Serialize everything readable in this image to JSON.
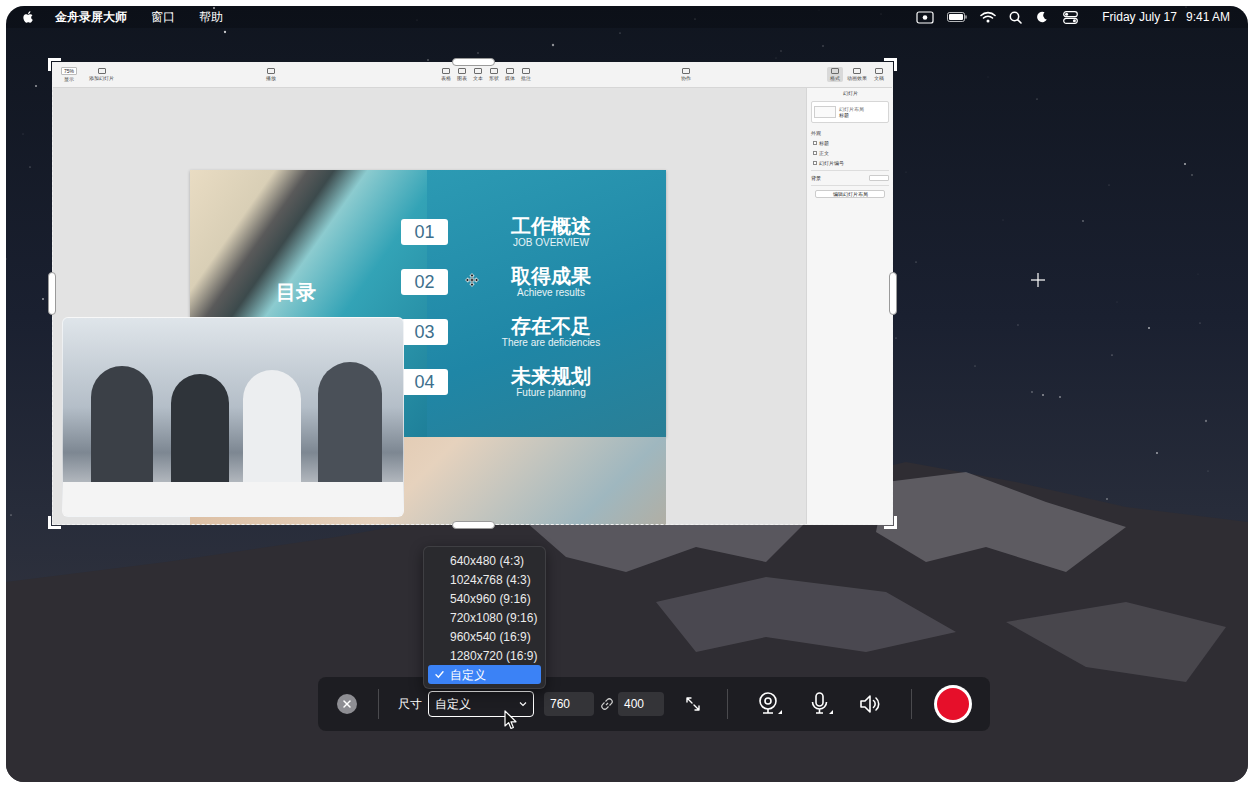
{
  "menu_bar": {
    "app_name": "金舟录屏大师",
    "menus": [
      "窗口",
      "帮助"
    ],
    "date": "Friday July 17",
    "time": "9:41 AM"
  },
  "capture_region": {
    "keynote": {
      "zoom": {
        "value": "75%",
        "label": "显示"
      },
      "add_slide": "添加幻灯片",
      "play": "播放",
      "insert_tools": [
        "表格",
        "图表",
        "文本",
        "形状",
        "媒体",
        "批注"
      ],
      "collaborate": "协作",
      "inspector_tabs": [
        {
          "label": "格式",
          "selected": true
        },
        {
          "label": "动画效果",
          "selected": false
        },
        {
          "label": "文稿",
          "selected": false
        }
      ],
      "inspector": {
        "title": "幻灯片",
        "layout_caption": "幻灯片布局",
        "layout_name": "标题",
        "appearance_label": "外观",
        "appearance_options": [
          "标题",
          "正文",
          "幻灯片编号"
        ],
        "background_label": "背景",
        "edit_layout_button": "编辑幻灯片布局"
      },
      "slide": {
        "heading": "目录",
        "items": [
          {
            "number": "01",
            "title": "工作概述",
            "subtitle": "JOB OVERVIEW"
          },
          {
            "number": "02",
            "title": "取得成果",
            "subtitle": "Achieve results"
          },
          {
            "number": "03",
            "title": "存在不足",
            "subtitle": "There are deficiencies"
          },
          {
            "number": "04",
            "title": "未来规划",
            "subtitle": "Future planning"
          }
        ]
      }
    }
  },
  "size_menu": {
    "options": [
      {
        "label": "640x480 (4:3)",
        "selected": false
      },
      {
        "label": "1024x768 (4:3)",
        "selected": false
      },
      {
        "label": "540x960 (9:16)",
        "selected": false
      },
      {
        "label": "720x1080 (9:16)",
        "selected": false
      },
      {
        "label": "960x540 (16:9)",
        "selected": false
      },
      {
        "label": "1280x720 (16:9)",
        "selected": false
      },
      {
        "label": "自定义",
        "selected": true
      }
    ]
  },
  "toolbar": {
    "size_label": "尺寸",
    "size_value": "自定义",
    "width": "760",
    "height": "400"
  }
}
